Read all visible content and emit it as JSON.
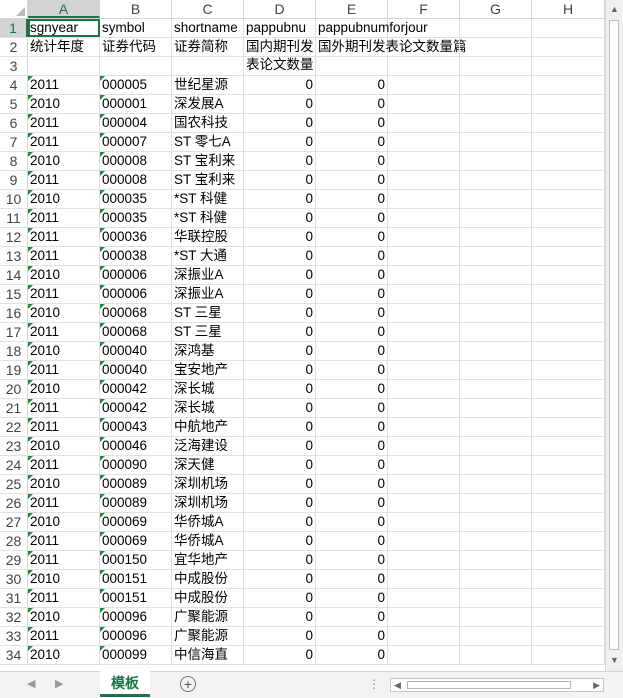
{
  "columns": [
    "A",
    "B",
    "C",
    "D",
    "E",
    "F",
    "G",
    "H"
  ],
  "header_row": [
    "sgnyear",
    "symbol",
    "shortname",
    "pappubnu",
    "pappubnumforjour"
  ],
  "label_row": [
    "统计年度",
    "证券代码",
    "证券简称",
    "国内期刊发表论文数量篇",
    "国外期刊发表论文数量篇"
  ],
  "rows": [
    {
      "n": "4",
      "year": "2011",
      "symbol": "000005",
      "name": "世纪星源",
      "d": "0",
      "e": "0"
    },
    {
      "n": "5",
      "year": "2010",
      "symbol": "000001",
      "name": "深发展A",
      "d": "0",
      "e": "0"
    },
    {
      "n": "6",
      "year": "2011",
      "symbol": "000004",
      "name": "国农科技",
      "d": "0",
      "e": "0"
    },
    {
      "n": "7",
      "year": "2011",
      "symbol": "000007",
      "name": "ST 零七A",
      "d": "0",
      "e": "0"
    },
    {
      "n": "8",
      "year": "2010",
      "symbol": "000008",
      "name": "ST 宝利来",
      "d": "0",
      "e": "0"
    },
    {
      "n": "9",
      "year": "2011",
      "symbol": "000008",
      "name": "ST 宝利来",
      "d": "0",
      "e": "0"
    },
    {
      "n": "10",
      "year": "2010",
      "symbol": "000035",
      "name": "*ST 科健",
      "d": "0",
      "e": "0"
    },
    {
      "n": "11",
      "year": "2011",
      "symbol": "000035",
      "name": "*ST 科健",
      "d": "0",
      "e": "0"
    },
    {
      "n": "12",
      "year": "2011",
      "symbol": "000036",
      "name": "华联控股",
      "d": "0",
      "e": "0"
    },
    {
      "n": "13",
      "year": "2011",
      "symbol": "000038",
      "name": "*ST 大通",
      "d": "0",
      "e": "0"
    },
    {
      "n": "14",
      "year": "2010",
      "symbol": "000006",
      "name": "深振业A",
      "d": "0",
      "e": "0"
    },
    {
      "n": "15",
      "year": "2011",
      "symbol": "000006",
      "name": "深振业A",
      "d": "0",
      "e": "0"
    },
    {
      "n": "16",
      "year": "2010",
      "symbol": "000068",
      "name": "ST 三星",
      "d": "0",
      "e": "0"
    },
    {
      "n": "17",
      "year": "2011",
      "symbol": "000068",
      "name": "ST 三星",
      "d": "0",
      "e": "0"
    },
    {
      "n": "18",
      "year": "2010",
      "symbol": "000040",
      "name": "深鸿基",
      "d": "0",
      "e": "0"
    },
    {
      "n": "19",
      "year": "2011",
      "symbol": "000040",
      "name": "宝安地产",
      "d": "0",
      "e": "0"
    },
    {
      "n": "20",
      "year": "2010",
      "symbol": "000042",
      "name": "深长城",
      "d": "0",
      "e": "0"
    },
    {
      "n": "21",
      "year": "2011",
      "symbol": "000042",
      "name": "深长城",
      "d": "0",
      "e": "0"
    },
    {
      "n": "22",
      "year": "2011",
      "symbol": "000043",
      "name": "中航地产",
      "d": "0",
      "e": "0"
    },
    {
      "n": "23",
      "year": "2010",
      "symbol": "000046",
      "name": "泛海建设",
      "d": "0",
      "e": "0"
    },
    {
      "n": "24",
      "year": "2011",
      "symbol": "000090",
      "name": "深天健",
      "d": "0",
      "e": "0"
    },
    {
      "n": "25",
      "year": "2010",
      "symbol": "000089",
      "name": "深圳机场",
      "d": "0",
      "e": "0"
    },
    {
      "n": "26",
      "year": "2011",
      "symbol": "000089",
      "name": "深圳机场",
      "d": "0",
      "e": "0"
    },
    {
      "n": "27",
      "year": "2010",
      "symbol": "000069",
      "name": "华侨城A",
      "d": "0",
      "e": "0"
    },
    {
      "n": "28",
      "year": "2011",
      "symbol": "000069",
      "name": "华侨城A",
      "d": "0",
      "e": "0"
    },
    {
      "n": "29",
      "year": "2011",
      "symbol": "000150",
      "name": "宜华地产",
      "d": "0",
      "e": "0"
    },
    {
      "n": "30",
      "year": "2010",
      "symbol": "000151",
      "name": "中成股份",
      "d": "0",
      "e": "0"
    },
    {
      "n": "31",
      "year": "2011",
      "symbol": "000151",
      "name": "中成股份",
      "d": "0",
      "e": "0"
    },
    {
      "n": "32",
      "year": "2010",
      "symbol": "000096",
      "name": "广聚能源",
      "d": "0",
      "e": "0"
    },
    {
      "n": "33",
      "year": "2011",
      "symbol": "000096",
      "name": "广聚能源",
      "d": "0",
      "e": "0"
    },
    {
      "n": "34",
      "year": "2010",
      "symbol": "000099",
      "name": "中信海直",
      "d": "0",
      "e": "0"
    }
  ],
  "sheet_tabs": [
    "模板"
  ],
  "add_sheet_glyph": "+",
  "scroll_arrows": {
    "up": "▲",
    "down": "▼",
    "left": "◀",
    "right": "▶"
  },
  "sheet_nav": {
    "prev": "◀",
    "next": "▶"
  },
  "more_dots": "⋮",
  "colors": {
    "accent": "#217346",
    "gridline": "#e1e1e1",
    "header_selected": "#d3d3d3"
  },
  "icons": [
    "select-all-triangle-icon",
    "add-sheet-icon",
    "scroll-arrow-icon"
  ]
}
